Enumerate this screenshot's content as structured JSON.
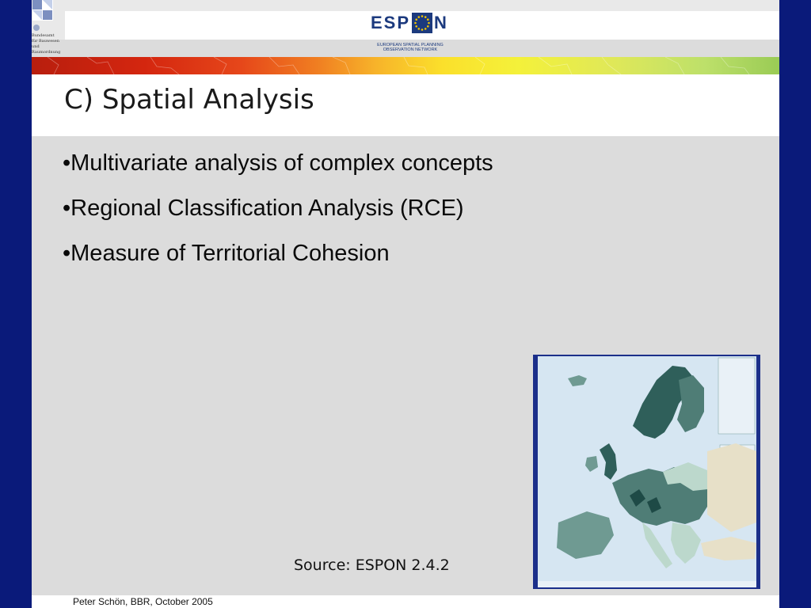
{
  "header": {
    "institution_lines": [
      "Bundesamt",
      "für Bauwesen und",
      "Raumordnung"
    ],
    "logo_word_left": "ESP",
    "logo_word_right": "N",
    "logo_subtitle_1": "EUROPEAN SPATIAL PLANNING",
    "logo_subtitle_2": "OBSERVATION NETWORK"
  },
  "slide": {
    "title": "C) Spatial Analysis",
    "bullets": [
      "•Multivariate analysis of complex concepts",
      "•Regional Classification Analysis (RCE)",
      "•Measure of Territorial Cohesion"
    ],
    "source": "Source: ESPON 2.4.2",
    "footer": "Peter Schön, BBR, October 2005"
  },
  "colors": {
    "frame": "#0a1a7a",
    "logo_blue": "#1c3a7e",
    "map_dark": "#2f5f5a",
    "map_mid": "#6f9a92",
    "map_light": "#bcd8cc",
    "map_beige": "#e7e0c8"
  },
  "icons": {
    "bbr_logo": "bbr-squares-icon",
    "espon_logo": "espon-star-circle-icon",
    "map": "europe-map-icon"
  }
}
